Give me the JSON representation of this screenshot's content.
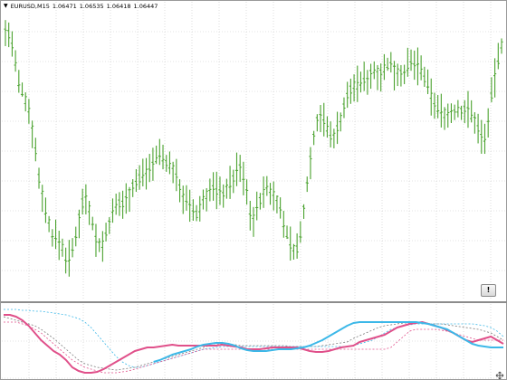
{
  "header": {
    "symbol": "EURUSD,M15",
    "open": "1.06471",
    "high": "1.06535",
    "low": "1.06418",
    "close": "1.06447",
    "dropdown_icon": "triangle-down-icon"
  },
  "alert_button_label": "!",
  "colors": {
    "background": "#ffffff",
    "grid": "#c8c8c8",
    "candle": "#4aa22e",
    "ind_pink": "#e0508a",
    "ind_cyan": "#3cb8e8",
    "ind_gray": "#7a7a7a"
  },
  "icons": {
    "resize": "resize-grip-icon"
  },
  "chart_data": [
    {
      "type": "ohlc",
      "series": [
        {
          "name": "EURUSD,M15",
          "y": [
            34,
            36,
            48,
            70,
            92,
            98,
            108,
            120,
            140,
            165,
            195,
            212,
            232,
            245,
            258,
            262,
            266,
            272,
            282,
            284,
            276,
            258,
            240,
            222,
            215,
            228,
            244,
            262,
            270,
            268,
            258,
            245,
            236,
            228,
            224,
            222,
            218,
            212,
            205,
            198,
            195,
            190,
            186,
            182,
            176,
            172,
            168,
            172,
            176,
            182,
            186,
            195,
            205,
            214,
            222,
            228,
            232,
            236,
            228,
            220,
            214,
            210,
            206,
            208,
            212,
            210,
            206,
            202,
            196,
            188,
            184,
            196,
            212,
            232,
            240,
            230,
            218,
            212,
            206,
            210,
            214,
            220,
            232,
            244,
            256,
            268,
            274,
            272,
            258,
            230,
            200,
            175,
            150,
            132,
            125,
            132,
            140,
            148,
            148,
            140,
            130,
            118,
            106,
            98,
            93,
            92,
            88,
            86,
            84,
            80,
            78,
            76,
            78,
            74,
            70,
            72,
            76,
            78,
            80,
            76,
            72,
            70,
            68,
            72,
            76,
            84,
            96,
            104,
            112,
            118,
            121,
            123,
            126,
            124,
            122,
            120,
            122,
            120,
            118,
            125,
            132,
            140,
            148,
            150,
            130,
            105,
            84,
            64,
            48
          ]
        }
      ]
    },
    {
      "type": "line",
      "series": [
        {
          "name": "pink-solid",
          "y": [
            12,
            12,
            14,
            18,
            24,
            32,
            40,
            46,
            52,
            56,
            62,
            70,
            74,
            76,
            76,
            75,
            72,
            68,
            64,
            60,
            56,
            52,
            50,
            48,
            48,
            47,
            46,
            45,
            46,
            46,
            46,
            46,
            46,
            46,
            46,
            45,
            46,
            47,
            48,
            50,
            50,
            50,
            49,
            48,
            48,
            48,
            48,
            48,
            50,
            52,
            53,
            53,
            52,
            50,
            48,
            47,
            46,
            42,
            40,
            38,
            36,
            34,
            30,
            26,
            24,
            22,
            21,
            20,
            22,
            24,
            26,
            29,
            32,
            36,
            40,
            42,
            40,
            38,
            36,
            40,
            44
          ]
        },
        {
          "name": "cyan-solid",
          "y": [
            null,
            null,
            null,
            null,
            null,
            null,
            null,
            null,
            null,
            null,
            null,
            null,
            null,
            null,
            null,
            null,
            null,
            null,
            null,
            null,
            null,
            null,
            null,
            null,
            64,
            62,
            59,
            56,
            54,
            52,
            50,
            47,
            45,
            44,
            43,
            43,
            44,
            46,
            49,
            51,
            52,
            52,
            52,
            51,
            50,
            50,
            50,
            49,
            48,
            46,
            43,
            40,
            36,
            32,
            28,
            24,
            21,
            20,
            20,
            20,
            20,
            20,
            20,
            20,
            20,
            20,
            20,
            21,
            22,
            24,
            26,
            28,
            32,
            36,
            40,
            44,
            46,
            47,
            48,
            48,
            48
          ]
        },
        {
          "name": "gray-dotted",
          "y": [
            14,
            16,
            18,
            20,
            22,
            24,
            28,
            33,
            38,
            44,
            50,
            56,
            62,
            66,
            68,
            70,
            71,
            72,
            73,
            72,
            71,
            70,
            68,
            66,
            64,
            62,
            60,
            58,
            56,
            54,
            52,
            50,
            48,
            46,
            45,
            44,
            44,
            45,
            46,
            46,
            46,
            46,
            46,
            46,
            46,
            46,
            47,
            47,
            47,
            47,
            47,
            46,
            45,
            44,
            43,
            42,
            38,
            35,
            32,
            29,
            26,
            24,
            23,
            22,
            21,
            21,
            21,
            21,
            22,
            22,
            22,
            23,
            24,
            25,
            26,
            27,
            28,
            30,
            32,
            36,
            40
          ]
        },
        {
          "name": "cyan-dotted",
          "y": [
            6,
            6,
            6,
            7,
            7,
            8,
            8,
            9,
            10,
            11,
            12,
            14,
            16,
            20,
            26,
            34,
            42,
            50,
            58,
            64,
            68,
            70,
            70,
            68,
            66,
            64,
            62,
            60,
            58,
            56,
            54,
            52,
            50,
            49,
            48,
            47,
            47,
            47,
            47,
            47,
            47,
            47,
            47,
            47,
            47,
            47,
            47,
            47,
            47,
            47,
            47,
            47,
            47,
            47,
            47,
            47,
            46,
            44,
            42,
            40,
            36,
            32,
            28,
            26,
            24,
            23,
            22,
            22,
            22,
            22,
            22,
            22,
            22,
            22,
            22,
            22,
            23,
            24,
            26,
            30,
            36
          ]
        },
        {
          "name": "pink-dotted",
          "y": [
            20,
            20,
            20,
            22,
            24,
            28,
            32,
            38,
            44,
            50,
            56,
            62,
            66,
            70,
            72,
            74,
            76,
            76,
            76,
            75,
            74,
            72,
            70,
            68,
            66,
            64,
            62,
            60,
            58,
            56,
            54,
            52,
            50,
            50,
            50,
            50,
            50,
            50,
            50,
            50,
            50,
            50,
            50,
            50,
            50,
            50,
            50,
            50,
            50,
            50,
            50,
            50,
            50,
            50,
            50,
            50,
            50,
            50,
            50,
            50,
            50,
            50,
            48,
            42,
            36,
            30,
            28,
            28,
            28,
            28,
            29,
            30,
            32,
            34,
            36,
            38,
            40,
            40,
            40,
            40,
            40
          ]
        }
      ]
    }
  ]
}
